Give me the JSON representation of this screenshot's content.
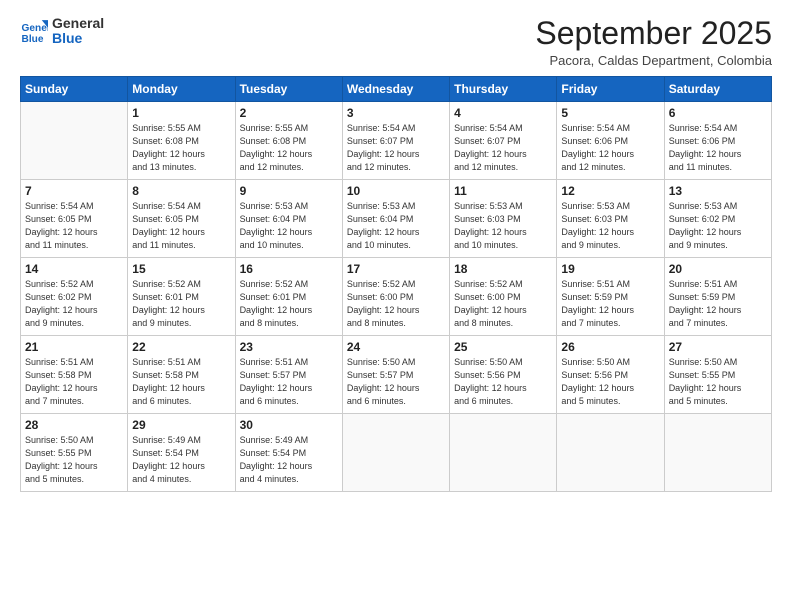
{
  "logo": {
    "line1": "General",
    "line2": "Blue"
  },
  "title": "September 2025",
  "location": "Pacora, Caldas Department, Colombia",
  "days_header": [
    "Sunday",
    "Monday",
    "Tuesday",
    "Wednesday",
    "Thursday",
    "Friday",
    "Saturday"
  ],
  "weeks": [
    [
      {
        "day": "",
        "sunrise": "",
        "sunset": "",
        "daylight": ""
      },
      {
        "day": "1",
        "sunrise": "5:55 AM",
        "sunset": "6:08 PM",
        "daylight": "12 hours and 13 minutes."
      },
      {
        "day": "2",
        "sunrise": "5:55 AM",
        "sunset": "6:08 PM",
        "daylight": "12 hours and 12 minutes."
      },
      {
        "day": "3",
        "sunrise": "5:54 AM",
        "sunset": "6:07 PM",
        "daylight": "12 hours and 12 minutes."
      },
      {
        "day": "4",
        "sunrise": "5:54 AM",
        "sunset": "6:07 PM",
        "daylight": "12 hours and 12 minutes."
      },
      {
        "day": "5",
        "sunrise": "5:54 AM",
        "sunset": "6:06 PM",
        "daylight": "12 hours and 12 minutes."
      },
      {
        "day": "6",
        "sunrise": "5:54 AM",
        "sunset": "6:06 PM",
        "daylight": "12 hours and 11 minutes."
      }
    ],
    [
      {
        "day": "7",
        "sunrise": "5:54 AM",
        "sunset": "6:05 PM",
        "daylight": "12 hours and 11 minutes."
      },
      {
        "day": "8",
        "sunrise": "5:54 AM",
        "sunset": "6:05 PM",
        "daylight": "12 hours and 11 minutes."
      },
      {
        "day": "9",
        "sunrise": "5:53 AM",
        "sunset": "6:04 PM",
        "daylight": "12 hours and 10 minutes."
      },
      {
        "day": "10",
        "sunrise": "5:53 AM",
        "sunset": "6:04 PM",
        "daylight": "12 hours and 10 minutes."
      },
      {
        "day": "11",
        "sunrise": "5:53 AM",
        "sunset": "6:03 PM",
        "daylight": "12 hours and 10 minutes."
      },
      {
        "day": "12",
        "sunrise": "5:53 AM",
        "sunset": "6:03 PM",
        "daylight": "12 hours and 9 minutes."
      },
      {
        "day": "13",
        "sunrise": "5:53 AM",
        "sunset": "6:02 PM",
        "daylight": "12 hours and 9 minutes."
      }
    ],
    [
      {
        "day": "14",
        "sunrise": "5:52 AM",
        "sunset": "6:02 PM",
        "daylight": "12 hours and 9 minutes."
      },
      {
        "day": "15",
        "sunrise": "5:52 AM",
        "sunset": "6:01 PM",
        "daylight": "12 hours and 9 minutes."
      },
      {
        "day": "16",
        "sunrise": "5:52 AM",
        "sunset": "6:01 PM",
        "daylight": "12 hours and 8 minutes."
      },
      {
        "day": "17",
        "sunrise": "5:52 AM",
        "sunset": "6:00 PM",
        "daylight": "12 hours and 8 minutes."
      },
      {
        "day": "18",
        "sunrise": "5:52 AM",
        "sunset": "6:00 PM",
        "daylight": "12 hours and 8 minutes."
      },
      {
        "day": "19",
        "sunrise": "5:51 AM",
        "sunset": "5:59 PM",
        "daylight": "12 hours and 7 minutes."
      },
      {
        "day": "20",
        "sunrise": "5:51 AM",
        "sunset": "5:59 PM",
        "daylight": "12 hours and 7 minutes."
      }
    ],
    [
      {
        "day": "21",
        "sunrise": "5:51 AM",
        "sunset": "5:58 PM",
        "daylight": "12 hours and 7 minutes."
      },
      {
        "day": "22",
        "sunrise": "5:51 AM",
        "sunset": "5:58 PM",
        "daylight": "12 hours and 6 minutes."
      },
      {
        "day": "23",
        "sunrise": "5:51 AM",
        "sunset": "5:57 PM",
        "daylight": "12 hours and 6 minutes."
      },
      {
        "day": "24",
        "sunrise": "5:50 AM",
        "sunset": "5:57 PM",
        "daylight": "12 hours and 6 minutes."
      },
      {
        "day": "25",
        "sunrise": "5:50 AM",
        "sunset": "5:56 PM",
        "daylight": "12 hours and 6 minutes."
      },
      {
        "day": "26",
        "sunrise": "5:50 AM",
        "sunset": "5:56 PM",
        "daylight": "12 hours and 5 minutes."
      },
      {
        "day": "27",
        "sunrise": "5:50 AM",
        "sunset": "5:55 PM",
        "daylight": "12 hours and 5 minutes."
      }
    ],
    [
      {
        "day": "28",
        "sunrise": "5:50 AM",
        "sunset": "5:55 PM",
        "daylight": "12 hours and 5 minutes."
      },
      {
        "day": "29",
        "sunrise": "5:49 AM",
        "sunset": "5:54 PM",
        "daylight": "12 hours and 4 minutes."
      },
      {
        "day": "30",
        "sunrise": "5:49 AM",
        "sunset": "5:54 PM",
        "daylight": "12 hours and 4 minutes."
      },
      {
        "day": "",
        "sunrise": "",
        "sunset": "",
        "daylight": ""
      },
      {
        "day": "",
        "sunrise": "",
        "sunset": "",
        "daylight": ""
      },
      {
        "day": "",
        "sunrise": "",
        "sunset": "",
        "daylight": ""
      },
      {
        "day": "",
        "sunrise": "",
        "sunset": "",
        "daylight": ""
      }
    ]
  ]
}
